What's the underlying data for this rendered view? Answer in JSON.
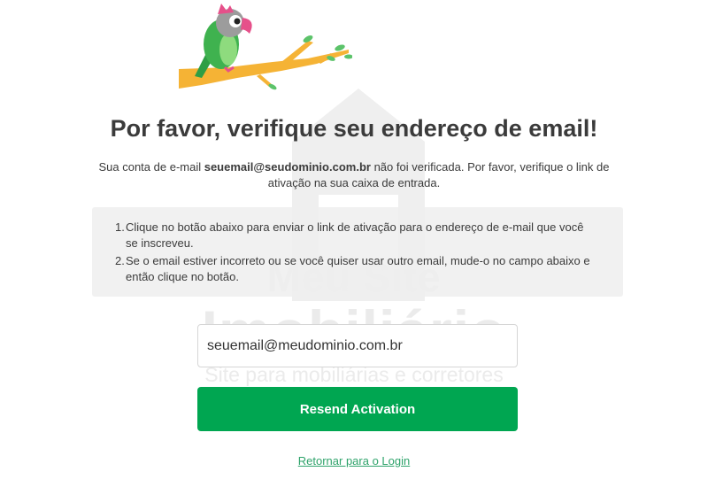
{
  "watermark": {
    "line1": "Meu Site",
    "line2": "Imobiliário",
    "tagline": "Site para mobiliárias e corretores"
  },
  "logo": {
    "icon": "parrot-on-branch-icon"
  },
  "title": "Por favor, verifique seu endereço de email!",
  "intro": {
    "before": "Sua conta de e-mail ",
    "email": "seuemail@seudominio.com.br",
    "after": " não foi verificada. Por favor, verifique o link de ativação na sua caixa de entrada."
  },
  "steps": [
    {
      "number": "1.",
      "text": "Clique no botão abaixo para enviar o link de ativação para o endereço de e-mail que você se inscreveu."
    },
    {
      "number": "2.",
      "text": "Se o email estiver incorreto ou se você quiser usar outro email, mude-o no campo abaixo e então clique no botão."
    }
  ],
  "email_field": {
    "value": "seuemail@meudominio.com.br"
  },
  "resend_button": {
    "label": "Resend Activation"
  },
  "back_link": {
    "label": "Retornar para o Login"
  },
  "colors": {
    "primary": "#00a651",
    "link": "#2fa36b",
    "panel": "#eeeeee",
    "text": "#3b3b3b"
  }
}
